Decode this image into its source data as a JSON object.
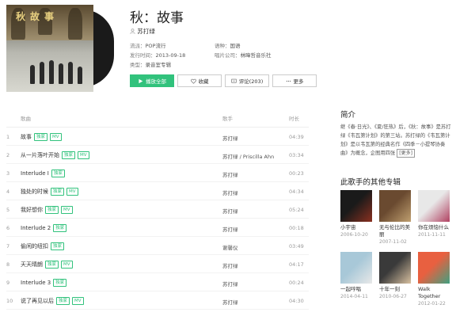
{
  "album": {
    "title": "秋：故事",
    "artist": "苏打绿",
    "cover_text": "秋故事",
    "meta": {
      "genre_label": "流派：",
      "genre": "POP流行",
      "language_label": "语种：",
      "language": "国语",
      "release_label": "发行时间：",
      "release": "2013-09-18",
      "company_label": "唱片公司：",
      "company": "林暐哲音乐社",
      "type_label": "类型：",
      "type": "录音室专辑"
    }
  },
  "actions": {
    "play_all": "播放全部",
    "favorite": "收藏",
    "comment": "评论(203)",
    "more": "更多"
  },
  "columns": {
    "song": "歌曲",
    "singer": "歌手",
    "duration": "时长"
  },
  "songs": [
    {
      "num": "1",
      "name": "故事",
      "tags": [
        "独家",
        "MV"
      ],
      "singer": "苏打绿",
      "duration": "04:39"
    },
    {
      "num": "2",
      "name": "从一片落叶开始",
      "tags": [
        "独家",
        "MV"
      ],
      "singer": "苏打绿 / Priscilla Ahn",
      "duration": "03:34"
    },
    {
      "num": "3",
      "name": "Interlude I",
      "tags": [
        "独家"
      ],
      "singer": "苏打绿",
      "duration": "00:23"
    },
    {
      "num": "4",
      "name": "独处的时候",
      "tags": [
        "独家",
        "MV"
      ],
      "singer": "苏打绿",
      "duration": "04:34"
    },
    {
      "num": "5",
      "name": "我好想你",
      "tags": [
        "独家",
        "MV"
      ],
      "singer": "苏打绿",
      "duration": "05:24"
    },
    {
      "num": "6",
      "name": "Interlude 2",
      "tags": [
        "独家"
      ],
      "singer": "苏打绿",
      "duration": "00:18"
    },
    {
      "num": "7",
      "name": "偷闲的纽扣",
      "tags": [
        "独家"
      ],
      "singer": "谢馨仪",
      "duration": "03:49"
    },
    {
      "num": "8",
      "name": "天天晴朗",
      "tags": [
        "独家",
        "MV"
      ],
      "singer": "苏打绿",
      "duration": "04:17"
    },
    {
      "num": "9",
      "name": "Interlude 3",
      "tags": [
        "独家"
      ],
      "singer": "苏打绿",
      "duration": "00:24"
    },
    {
      "num": "10",
      "name": "说了再见以后",
      "tags": [
        "独家",
        "MV"
      ],
      "singer": "苏打绿",
      "duration": "04:30"
    }
  ],
  "intro": {
    "title": "简介",
    "text": "继《春·日光》、《夏/狂热》后，《秋：故事》是苏打绿《韦瓦第计划》的第三站。苏打绿的《韦瓦第计划》是以韦瓦第的经典名作《四季－小提琴协奏曲》为概念，企图用四张",
    "more": "[更多]"
  },
  "other_albums": {
    "title": "此歌手的其他专辑",
    "items": [
      {
        "name": "小宇宙",
        "date": "2006-10-20",
        "colors": [
          "#1a1a1a",
          "#8a3020"
        ]
      },
      {
        "name": "无与伦比的美丽",
        "date": "2007-11-02",
        "colors": [
          "#6a4a30",
          "#c0a070"
        ]
      },
      {
        "name": "你在烦恼什么",
        "date": "2011-11-11",
        "colors": [
          "#e8e8e8",
          "#b04060"
        ]
      },
      {
        "name": "一起哼唱",
        "date": "2014-04-11",
        "colors": [
          "#a8c8d8",
          "#e8e8e8"
        ]
      },
      {
        "name": "十年一刻",
        "date": "2010-06-27",
        "colors": [
          "#3a3a3a",
          "#d8c0a0"
        ]
      },
      {
        "name": "Walk Together",
        "date": "2012-01-22",
        "colors": [
          "#e86040",
          "#40a080"
        ]
      }
    ]
  }
}
